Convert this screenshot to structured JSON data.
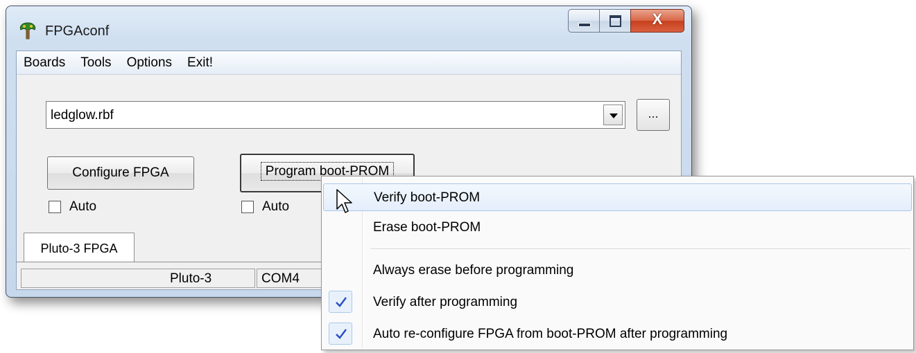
{
  "window": {
    "title": "FPGAconf",
    "close_glyph": "X",
    "icon": "fpga-tree-icon"
  },
  "menubar": {
    "items": [
      "Boards",
      "Tools",
      "Options",
      "Exit!"
    ]
  },
  "file_combo": {
    "value": "ledglow.rbf",
    "browse_label": "..."
  },
  "buttons": {
    "configure": "Configure FPGA",
    "program": "Program boot-PROM"
  },
  "checkboxes": {
    "auto1": {
      "label": "Auto",
      "checked": false
    },
    "auto2": {
      "label": "Auto",
      "checked": false
    }
  },
  "tab": {
    "label": "Pluto-3 FPGA"
  },
  "statusbar": {
    "board": "Pluto-3",
    "port": "COM4"
  },
  "context_menu": {
    "items": [
      {
        "label": "Verify boot-PROM",
        "checked": false,
        "highlighted": true
      },
      {
        "label": "Erase boot-PROM",
        "checked": false,
        "highlighted": false
      },
      {
        "label": "Always erase before programming",
        "checked": false,
        "highlighted": false
      },
      {
        "label": "Verify after programming",
        "checked": true,
        "highlighted": false
      },
      {
        "label": "Auto re-configure FPGA from boot-PROM after programming",
        "checked": true,
        "highlighted": false
      }
    ]
  },
  "colors": {
    "check_mark": "#2b4fc4",
    "highlight_border": "#a8c4ea",
    "close_button": "#c7401d"
  }
}
